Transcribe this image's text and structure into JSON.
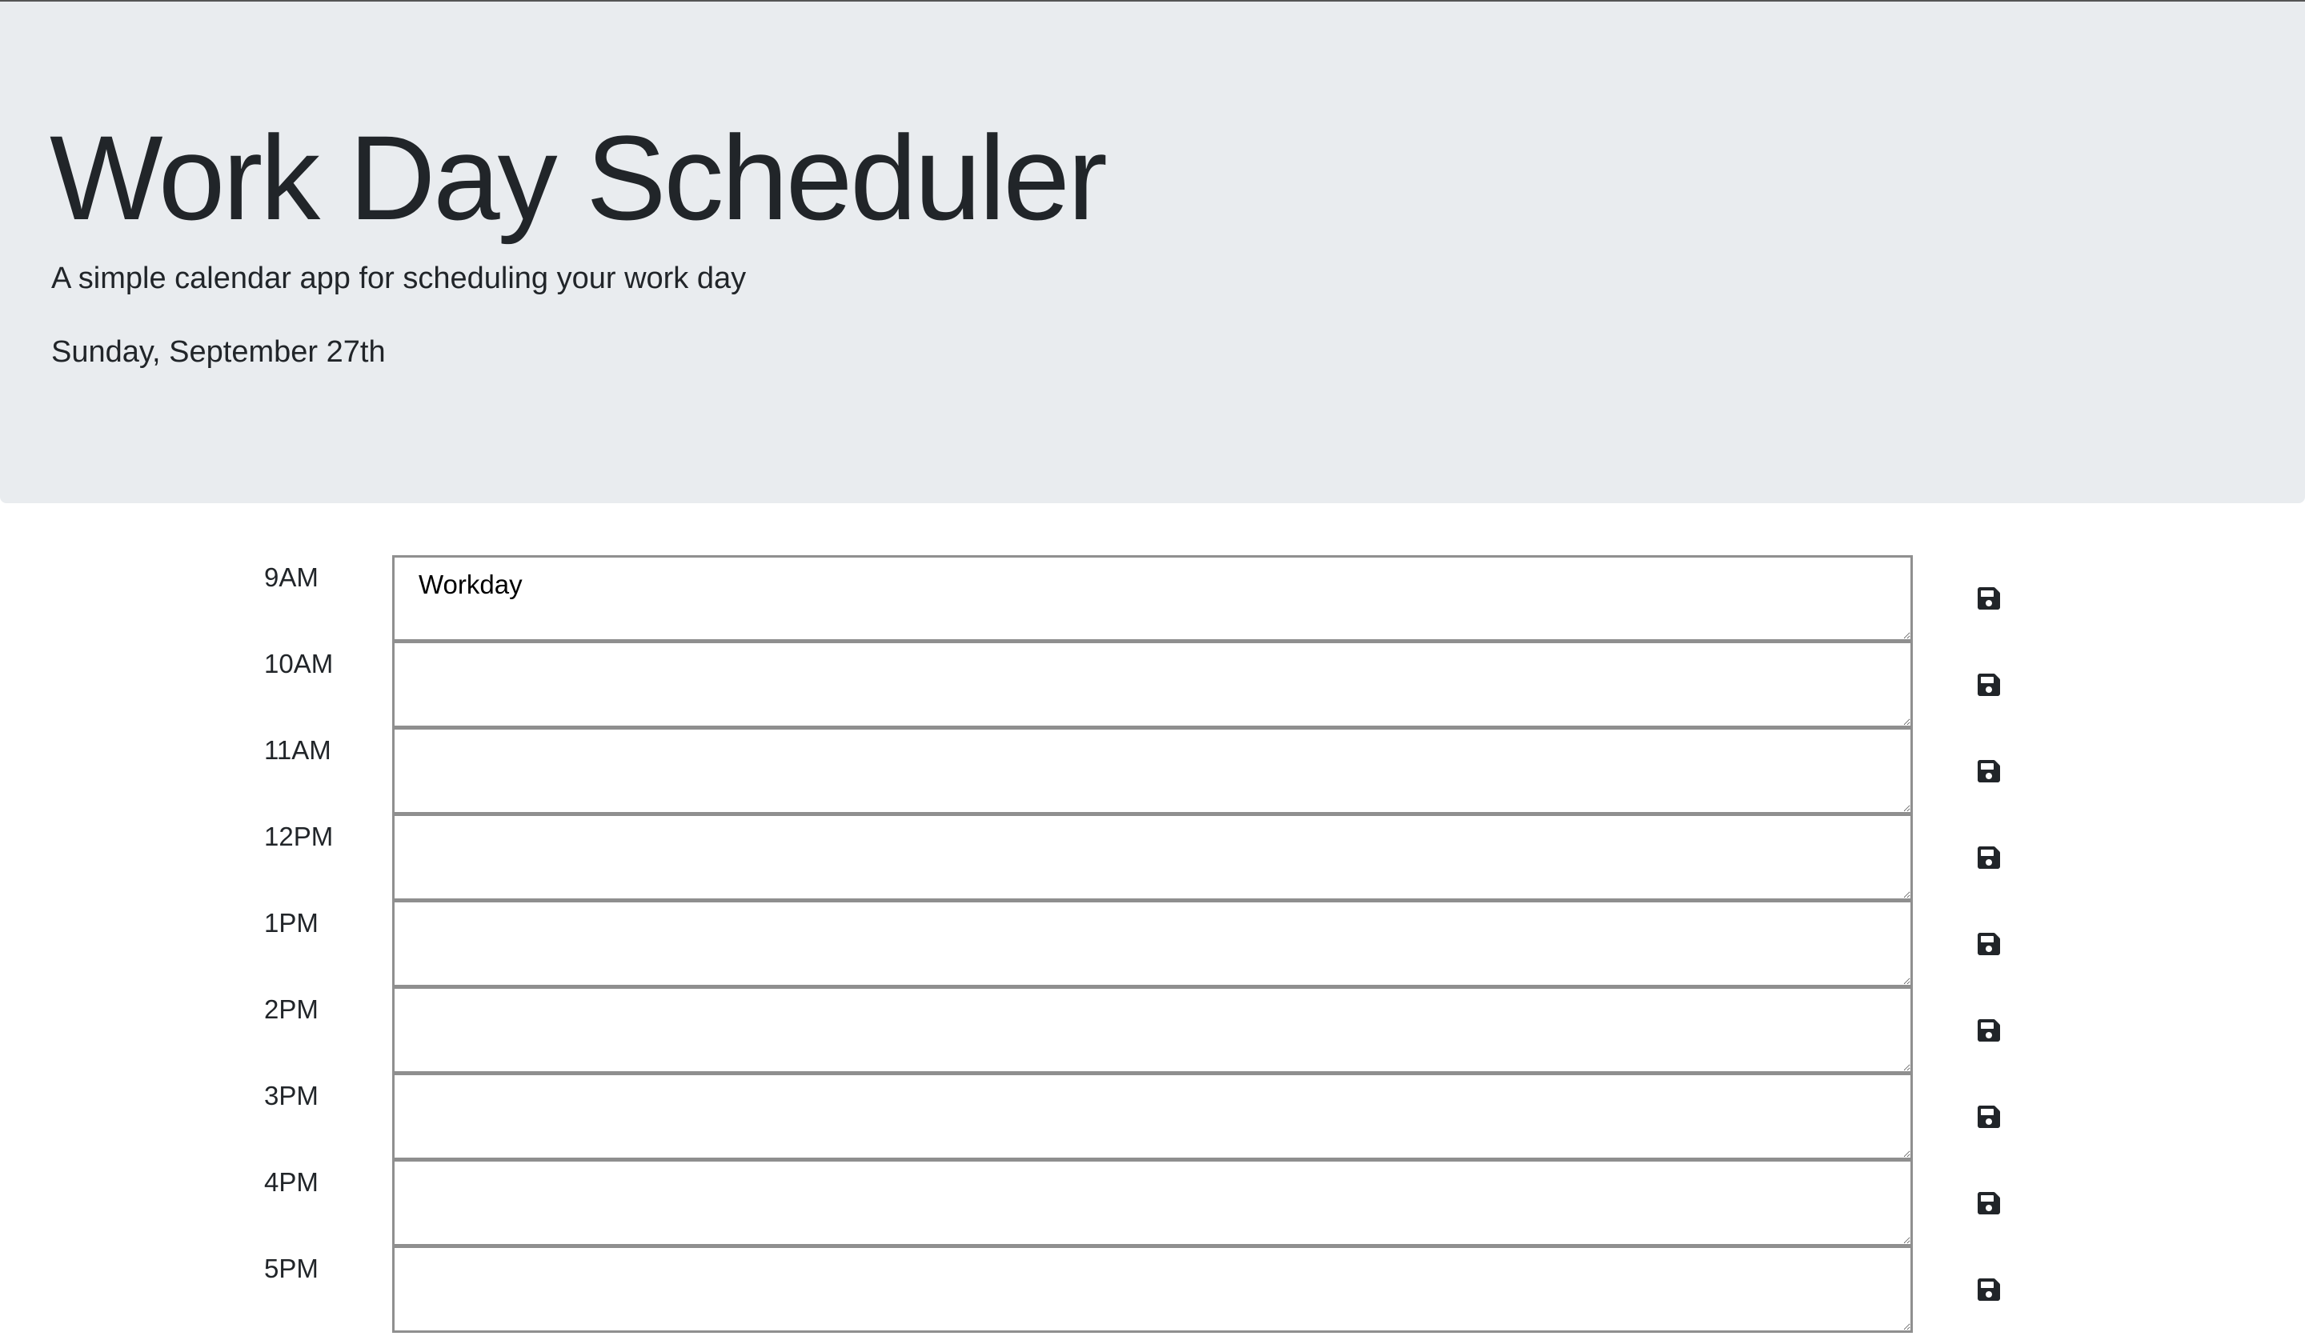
{
  "header": {
    "title": "Work Day Scheduler",
    "subtitle": "A simple calendar app for scheduling your work day",
    "current_day": "Sunday, September 27th"
  },
  "schedule": {
    "save_icon": "floppy-disk-save-icon",
    "rows": [
      {
        "hour": "9AM",
        "text": "Workday"
      },
      {
        "hour": "10AM",
        "text": ""
      },
      {
        "hour": "11AM",
        "text": ""
      },
      {
        "hour": "12PM",
        "text": ""
      },
      {
        "hour": "1PM",
        "text": ""
      },
      {
        "hour": "2PM",
        "text": ""
      },
      {
        "hour": "3PM",
        "text": ""
      },
      {
        "hour": "4PM",
        "text": ""
      },
      {
        "hour": "5PM",
        "text": ""
      }
    ]
  },
  "colors": {
    "header_background": "#e9ecef",
    "text": "#212529",
    "textarea_border": "#8f8f8f"
  }
}
